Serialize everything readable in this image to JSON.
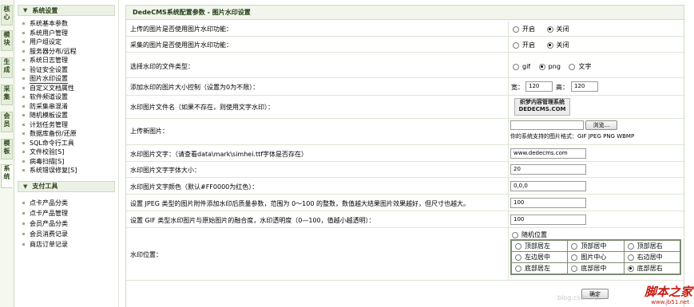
{
  "vtabs": [
    "核心",
    "模块",
    "生成",
    "采集",
    "会员",
    "模板",
    "系统"
  ],
  "menu": {
    "section1": "系统设置",
    "items1": [
      "系统基本参数",
      "系统用户管理",
      "用户组设定",
      "服务器分布/远程",
      "系统日志管理",
      "验证安全设置",
      "图片水印设置",
      "自定义文档属性",
      "软件频道设置",
      "防采集串混淆",
      "随机模板设置",
      "计划任务管理",
      "数据库备份/还原",
      "SQL命令行工具",
      "文件校验[S]",
      "病毒扫描[S]",
      "系统错误修复[S]"
    ],
    "section2": "支付工具",
    "items2": [
      "点卡产品分类",
      "点卡产品管理",
      "会员产品分类",
      "会员消费记录",
      "商店订单记录"
    ]
  },
  "main": {
    "title": "DedeCMS系统配置参数 - 图片水印设置",
    "rows": {
      "upload_label": "上传的图片是否使用图片水印功能：",
      "collect_label": "采集的图片是否使用图片水印功能：",
      "type_label": "选择水印的文件类型：",
      "size_label": "添加水印的图片大小控制（设置为0为不限）：",
      "file_label": "水印图片文件名（如果不存在，则使用文字水印）：",
      "newimg_label": "上传新图片：",
      "text_label": "水印图片文字：（请查看data\\mark\\simhei.ttf字体是否存在）",
      "fontsize_label": "水印图片文字字体大小：",
      "color_label": "水印图片文字颜色（默认#FF0000为红色）：",
      "jpeg_label": "设置 JPEG 类型的图片附件添加水印后质量参数，范围为 0～100 的整数，数值越大结果图片效果越好，但尺寸也越大。",
      "gif_label": "设置 GIF 类型水印图片与原始图片的融合度，水印透明度（0—100，值越小越透明）：",
      "pos_label": "水印位置："
    },
    "opt_on": "开启",
    "opt_off": "关闭",
    "types": [
      "gif",
      "png",
      "文字"
    ],
    "width_label": "宽：",
    "width_value": "120",
    "height_label": "高：",
    "height_value": "120",
    "logo_line1": "织梦内容管理系统",
    "logo_line2": "DEDECMS.COM",
    "browse_label": "浏览...",
    "formats_note": "你的系统支持的图片格式：GIF JPEG PNG WBMP",
    "text_value": "www.dedecms.com",
    "fontsize_value": "20",
    "color_value": "0,0,0",
    "jpeg_value": "100",
    "gif_value": "100",
    "random_pos": "随机位置",
    "positions": [
      [
        "顶部居左",
        "顶部居中",
        "顶部居右"
      ],
      [
        "左边居中",
        "图片中心",
        "右边居中"
      ],
      [
        "底部居左",
        "底部居中",
        "底部居右"
      ]
    ],
    "submit_label": "确定"
  },
  "brand": {
    "line1": "脚本之家",
    "line2": "www.jb51.net"
  },
  "faint_text": "blog.csdn.net"
}
